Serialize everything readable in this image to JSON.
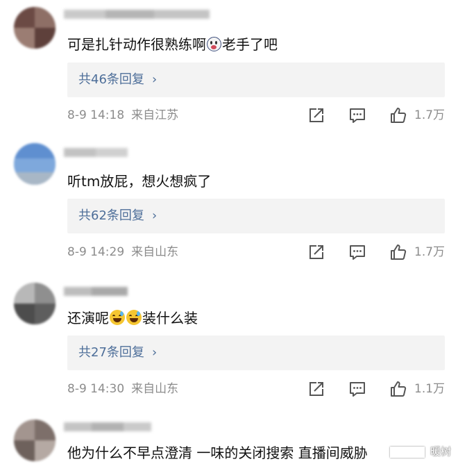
{
  "comments": [
    {
      "text_before_emoji": "可是扎针动作很熟练啊",
      "text_after_emoji": "老手了吧",
      "reply_label": "共46条回复",
      "date": "8-9 14:18",
      "location": "来自江苏",
      "likes": "1.7万"
    },
    {
      "text": "听tm放屁，想火想疯了",
      "reply_label": "共62条回复",
      "date": "8-9 14:29",
      "location": "来自山东",
      "likes": "1.7万"
    },
    {
      "text_before_emoji": "还演呢",
      "text_after_emoji": "装什么装",
      "reply_label": "共27条回复",
      "date": "8-9 14:30",
      "location": "来自山东",
      "likes": "1.1万"
    },
    {
      "text": "他为什么不早点澄清 一味的关闭搜索 直播间威胁"
    }
  ],
  "reply_chevron": "›",
  "watermark": "暖树",
  "colors": {
    "reply_text": "#4d6e99",
    "meta_text": "#8c8c8c",
    "reply_bg": "#f3f3f3",
    "emoji_yellow": "#f5c631"
  },
  "icons": {
    "share": "share-icon",
    "comment": "comment-icon",
    "like": "thumbs-up-icon"
  }
}
